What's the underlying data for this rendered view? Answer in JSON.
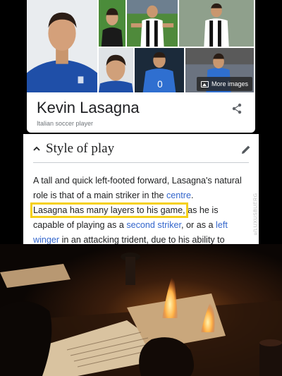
{
  "panel": {
    "title": "Kevin Lasagna",
    "subtitle": "Italian soccer player",
    "more_images_label": "More images",
    "icons": {
      "share": "share-icon",
      "more_images": "image-icon"
    }
  },
  "wiki": {
    "section_title": "Style of play",
    "icons": {
      "collapse": "chevron-up-icon",
      "edit": "pencil-icon"
    },
    "paragraph": {
      "t1": "A tall and quick left-footed forward, Lasagna's natural role is that of a main striker in the ",
      "l1": "centre",
      "t2": ".",
      "highlight": "Lasagna has many layers to his game,",
      "t3": " as he is capable of playing as a ",
      "l2": "second striker",
      "t4": ", or as a ",
      "l3": "left winger",
      "t5": " in an attacking trident, due to his ability to"
    },
    "watermark": "u/LUXUSBUERG"
  },
  "colors": {
    "link": "#3366cc",
    "highlight": "#f5d01a",
    "fire": "#ff9a2e"
  }
}
